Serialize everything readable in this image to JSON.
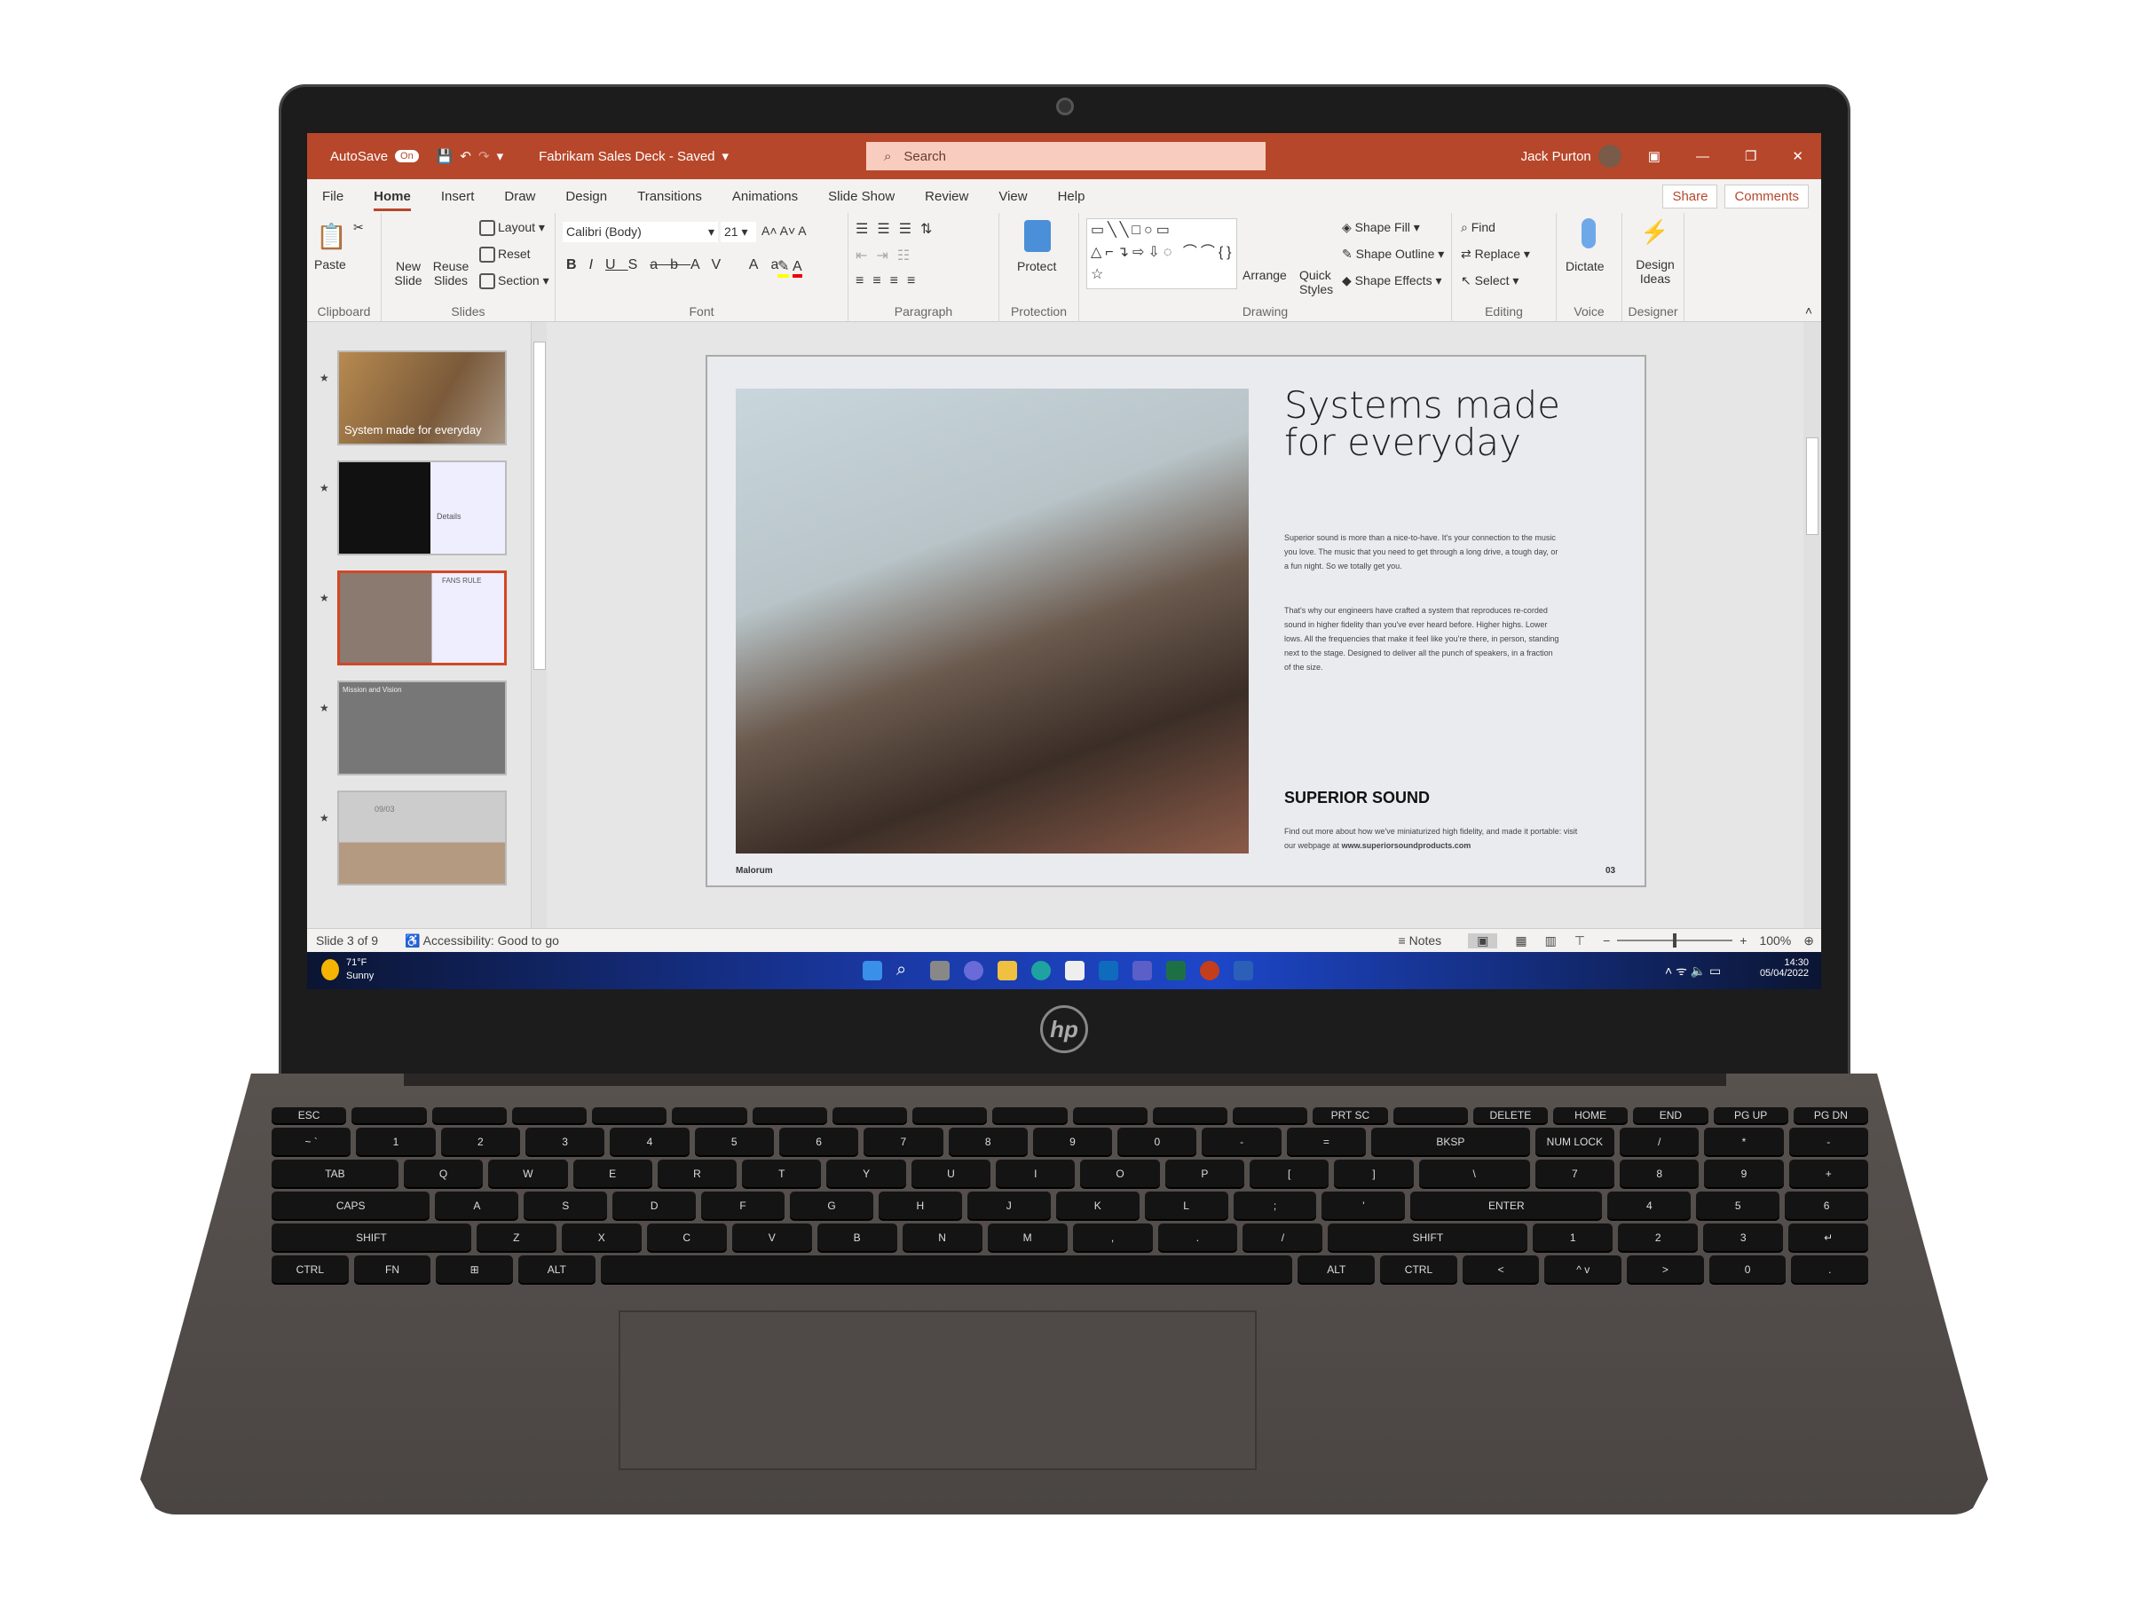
{
  "titlebar": {
    "autosave": "AutoSave",
    "autosave_state": "On",
    "doc_title": "Fabrikam Sales Deck - Saved",
    "search_placeholder": "Search",
    "user": "Jack Purton"
  },
  "tabs": [
    "File",
    "Home",
    "Insert",
    "Draw",
    "Design",
    "Transitions",
    "Animations",
    "Slide Show",
    "Review",
    "View",
    "Help"
  ],
  "share": "Share",
  "comments": "Comments",
  "ribbon": {
    "clipboard": {
      "label": "Clipboard",
      "paste": "Paste"
    },
    "slides": {
      "label": "Slides",
      "new_slide": "New Slide",
      "reuse": "Reuse Slides",
      "layout": "Layout",
      "reset": "Reset",
      "section": "Section"
    },
    "font": {
      "label": "Font",
      "family": "Calibri (Body)",
      "size": "21"
    },
    "paragraph": {
      "label": "Paragraph"
    },
    "protection": {
      "label": "Protection",
      "protect": "Protect"
    },
    "drawing": {
      "label": "Drawing",
      "arrange": "Arrange",
      "quick_styles": "Quick Styles",
      "shape_fill": "Shape Fill",
      "shape_outline": "Shape Outline",
      "shape_effects": "Shape Effects"
    },
    "editing": {
      "label": "Editing",
      "find": "Find",
      "replace": "Replace",
      "select": "Select"
    },
    "voice": {
      "label": "Voice",
      "dictate": "Dictate"
    },
    "designer": {
      "label": "Designer",
      "ideas": "Design Ideas"
    }
  },
  "thumbnails": [
    {
      "text": "System made for everyday"
    },
    {
      "text": "Details"
    },
    {
      "text": "FANS RULE"
    },
    {
      "text": "Mission and Vision"
    },
    {
      "text": "09/03"
    }
  ],
  "slide": {
    "title_line1": "Systems made",
    "title_line2": "for everyday",
    "para1": "Superior sound is more than a nice-to-have. It's your connection to the music you love. The music that you need to get through a long drive, a tough day, or a fun night. So we totally get you.",
    "para2": "That's why our engineers have crafted a system that reproduces re-corded sound in higher fidelity than you've ever heard before. Higher highs. Lower lows. All the frequencies that make it feel like you're there, in person, standing next to the stage. Designed to deliver all the punch of speakers, in a fraction of the size.",
    "subtitle": "SUPERIOR SOUND",
    "footer_text": "Find out more about how we've miniaturized high fidelity, and made it portable: visit our webpage at",
    "footer_link": "www.superiorsoundproducts.com",
    "brand": "Malorum",
    "page": "03"
  },
  "status": {
    "slide": "Slide 3 of 9",
    "accessibility": "Accessibility: Good to go",
    "notes": "Notes",
    "zoom": "100%",
    "zoom_fraction": 0.5
  },
  "taskbar": {
    "temp": "71°F",
    "weather": "Sunny",
    "time": "14:30",
    "date": "05/04/2022"
  },
  "colors": {
    "accent": "#b7472a",
    "selected_thumb": "#d24726"
  },
  "keyboard": [
    [
      "ESC",
      "",
      "",
      "",
      "",
      "",
      "",
      "",
      "",
      "",
      "",
      "",
      "",
      "PRT SC",
      "",
      "DELETE",
      "HOME",
      "END",
      "PG UP",
      "PG DN"
    ],
    [
      "~ `",
      "1",
      "2",
      "3",
      "4",
      "5",
      "6",
      "7",
      "8",
      "9",
      "0",
      "-",
      "=",
      "BKSP",
      "NUM LOCK",
      "/",
      "*",
      "-"
    ],
    [
      "TAB",
      "Q",
      "W",
      "E",
      "R",
      "T",
      "Y",
      "U",
      "I",
      "O",
      "P",
      "[",
      "]",
      "\\",
      "7",
      "8",
      "9",
      "+"
    ],
    [
      "CAPS",
      "A",
      "S",
      "D",
      "F",
      "G",
      "H",
      "J",
      "K",
      "L",
      ";",
      "'",
      "ENTER",
      "4",
      "5",
      "6"
    ],
    [
      "SHIFT",
      "Z",
      "X",
      "C",
      "V",
      "B",
      "N",
      "M",
      ",",
      ".",
      "/",
      "SHIFT",
      "1",
      "2",
      "3",
      "↵"
    ],
    [
      "CTRL",
      "FN",
      "⊞",
      "ALT",
      "",
      "ALT",
      "CTRL",
      "<",
      "^ v",
      ">",
      "0",
      "."
    ]
  ],
  "logo": "hp"
}
